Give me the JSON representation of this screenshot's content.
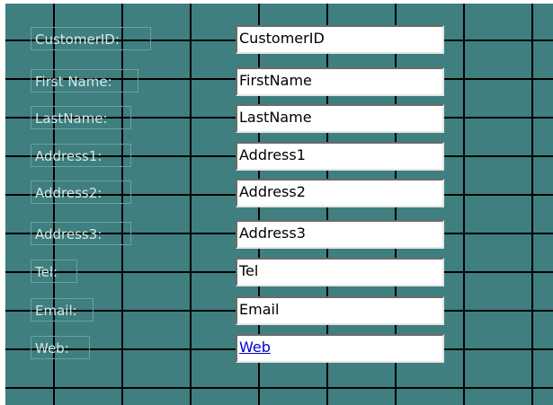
{
  "form": {
    "rows": [
      {
        "label": "CustomerID:",
        "value": "CustomerID",
        "is_link": false
      },
      {
        "label": "First Name:",
        "value": "FirstName",
        "is_link": false
      },
      {
        "label": "LastName:",
        "value": "LastName",
        "is_link": false
      },
      {
        "label": "Address1:",
        "value": "Address1",
        "is_link": false
      },
      {
        "label": "Address2:",
        "value": "Address2",
        "is_link": false
      },
      {
        "label": "Address3:",
        "value": "Address3",
        "is_link": false
      },
      {
        "label": "Tel:",
        "value": "Tel",
        "is_link": false
      },
      {
        "label": "Email:",
        "value": "Email",
        "is_link": false
      },
      {
        "label": "Web:",
        "value": "Web",
        "is_link": true
      }
    ]
  },
  "colors": {
    "design_grid_background": "#3f7f7f",
    "grid_lines": "#000000",
    "label_text": "#d9e6e6",
    "field_background": "#ffffff",
    "link_text": "#0000cc"
  }
}
